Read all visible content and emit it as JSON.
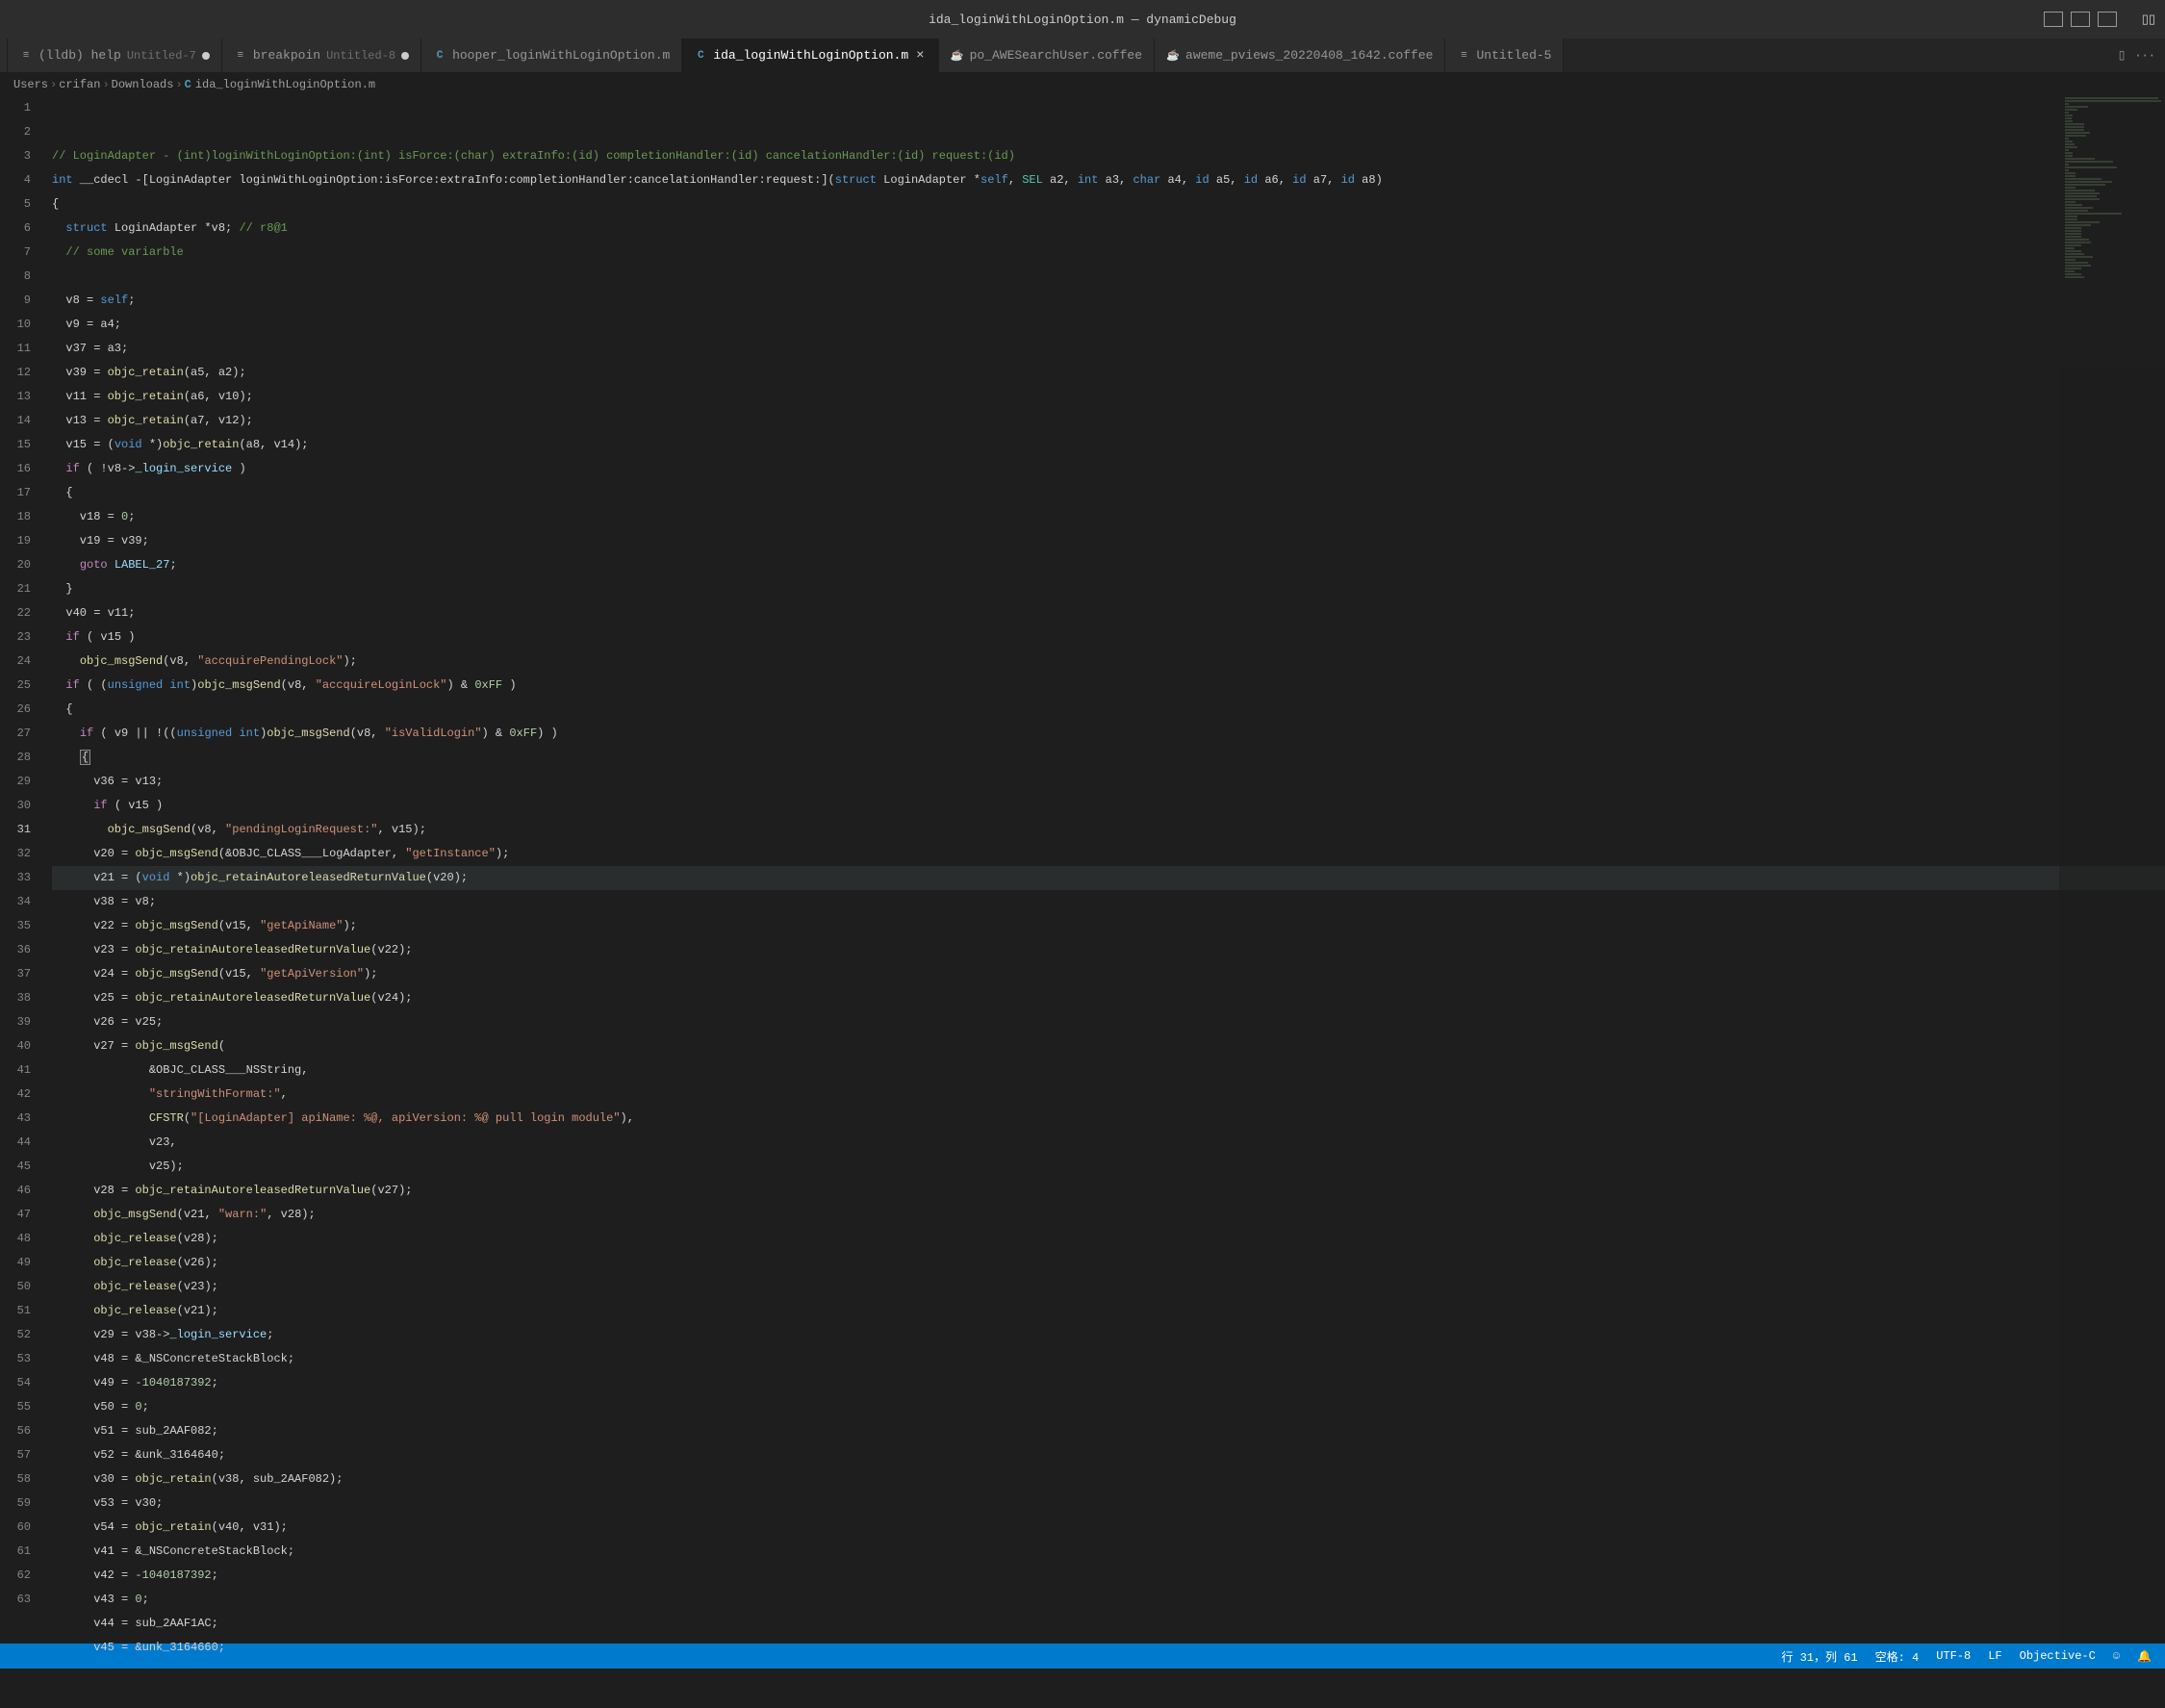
{
  "title": "ida_loginWithLoginOption.m — dynamicDebug",
  "tabs": [
    {
      "label": "(lldb) help",
      "sub": "Untitled-7",
      "icon": "text",
      "dirty": true
    },
    {
      "label": "breakpoin",
      "sub": "Untitled-8",
      "icon": "text",
      "dirty": true
    },
    {
      "label": "hooper_loginWithLoginOption.m",
      "icon": "C"
    },
    {
      "label": "ida_loginWithLoginOption.m",
      "icon": "C",
      "active": true,
      "closeable": true
    },
    {
      "label": "po_AWESearchUser.coffee",
      "icon": "coffee"
    },
    {
      "label": "aweme_pviews_20220408_1642.coffee",
      "icon": "coffee"
    },
    {
      "label": "Untitled-5",
      "icon": "text"
    }
  ],
  "breadcrumbs": {
    "parts": [
      "Users",
      "crifan",
      "Downloads"
    ],
    "file_icon": "C",
    "file": "ida_loginWithLoginOption.m"
  },
  "cursor": {
    "line": 31,
    "col": 61
  },
  "status": {
    "lncol": "行 31，列 61",
    "spaces": "空格: 4",
    "encoding": "UTF-8",
    "eol": "LF",
    "lang": "Objective-C"
  },
  "code": {
    "first_line": 1,
    "lines": [
      {
        "n": 1,
        "html": "<span class='c-comment'>// LoginAdapter - (int)loginWithLoginOption:(int) isForce:(char) extraInfo:(id) completionHandler:(id) cancelationHandler:(id) request:(id)</span>"
      },
      {
        "n": 2,
        "html": "<span class='c-type'>int</span> __cdecl -[LoginAdapter loginWithLoginOption:isForce:extraInfo:completionHandler:cancelationHandler:request:](<span class='c-type'>struct</span> LoginAdapter *<span class='c-self'>self</span>, <span class='c-enum'>SEL</span> a2, <span class='c-type'>int</span> a3, <span class='c-type'>char</span> a4, <span class='c-type'>id</span> a5, <span class='c-type'>id</span> a6, <span class='c-type'>id</span> a7, <span class='c-type'>id</span> a8)"
      },
      {
        "n": 3,
        "html": "{"
      },
      {
        "n": 4,
        "html": "  <span class='c-type'>struct</span> LoginAdapter *v8; <span class='c-comment'>// r8@1</span>"
      },
      {
        "n": 5,
        "html": "  <span class='c-comment'>// some variarble</span>"
      },
      {
        "n": 6,
        "html": ""
      },
      {
        "n": 7,
        "html": "  v8 = <span class='c-self'>self</span>;"
      },
      {
        "n": 8,
        "html": "  v9 = a4;"
      },
      {
        "n": 9,
        "html": "  v37 = a3;"
      },
      {
        "n": 10,
        "html": "  v39 = <span class='c-func'>objc_retain</span>(a5, a2);"
      },
      {
        "n": 11,
        "html": "  v11 = <span class='c-func'>objc_retain</span>(a6, v10);"
      },
      {
        "n": 12,
        "html": "  v13 = <span class='c-func'>objc_retain</span>(a7, v12);"
      },
      {
        "n": 13,
        "html": "  v15 = (<span class='c-type'>void</span> *)<span class='c-func'>objc_retain</span>(a8, v14);"
      },
      {
        "n": 14,
        "html": "  <span class='c-keyword'>if</span> ( !v8-&gt;<span class='c-prop'>_login_service</span> )"
      },
      {
        "n": 15,
        "html": "  {"
      },
      {
        "n": 16,
        "html": "    v18 = <span class='c-num'>0</span>;"
      },
      {
        "n": 17,
        "html": "    v19 = v39;"
      },
      {
        "n": 18,
        "html": "    <span class='c-keyword'>goto</span> <span class='c-var'>LABEL_27</span>;"
      },
      {
        "n": 19,
        "html": "  }"
      },
      {
        "n": 20,
        "html": "  v40 = v11;"
      },
      {
        "n": 21,
        "html": "  <span class='c-keyword'>if</span> ( v15 )"
      },
      {
        "n": 22,
        "html": "    <span class='c-func'>objc_msgSend</span>(v8, <span class='c-str'>\"accquirePendingLock\"</span>);"
      },
      {
        "n": 23,
        "html": "  <span class='c-keyword'>if</span> ( (<span class='c-type'>unsigned int</span>)<span class='c-func'>objc_msgSend</span>(v8, <span class='c-str'>\"accquireLoginLock\"</span>) &amp; <span class='c-num'>0xFF</span> )"
      },
      {
        "n": 24,
        "html": "  {"
      },
      {
        "n": 25,
        "html": "    <span class='c-keyword'>if</span> ( v9 || !((<span class='c-type'>unsigned int</span>)<span class='c-func'>objc_msgSend</span>(v8, <span class='c-str'>\"isValidLogin\"</span>) &amp; <span class='c-num'>0xFF</span>) )"
      },
      {
        "n": 26,
        "html": "    <span class='c-bracket-match'>{</span>"
      },
      {
        "n": 27,
        "html": "      v36 = v13;"
      },
      {
        "n": 28,
        "html": "      <span class='c-keyword'>if</span> ( v15 )"
      },
      {
        "n": 29,
        "html": "        <span class='c-func'>objc_msgSend</span>(v8, <span class='c-str'>\"pendingLoginRequest:\"</span>, v15);"
      },
      {
        "n": 30,
        "html": "      v20 = <span class='c-func'>objc_msgSend</span>(&amp;OBJC_CLASS___LogAdapter, <span class='c-str'>\"getInstance\"</span>);"
      },
      {
        "n": 31,
        "hl": true,
        "html": "      v21 = (<span class='c-type'>void</span> *)<span class='c-func'>objc_retainAutoreleasedReturnValue</span>(v20);"
      },
      {
        "n": 32,
        "html": "      v38 = v8;"
      },
      {
        "n": 33,
        "html": "      v22 = <span class='c-func'>objc_msgSend</span>(v15, <span class='c-str'>\"getApiName\"</span>);"
      },
      {
        "n": 34,
        "html": "      v23 = <span class='c-func'>objc_retainAutoreleasedReturnValue</span>(v22);"
      },
      {
        "n": 35,
        "html": "      v24 = <span class='c-func'>objc_msgSend</span>(v15, <span class='c-str'>\"getApiVersion\"</span>);"
      },
      {
        "n": 36,
        "html": "      v25 = <span class='c-func'>objc_retainAutoreleasedReturnValue</span>(v24);"
      },
      {
        "n": 37,
        "html": "      v26 = v25;"
      },
      {
        "n": 38,
        "html": "      v27 = <span class='c-func'>objc_msgSend</span>("
      },
      {
        "n": 39,
        "html": "              &amp;OBJC_CLASS___NSString,"
      },
      {
        "n": 40,
        "html": "              <span class='c-str'>\"stringWithFormat:\"</span>,"
      },
      {
        "n": 41,
        "html": "              <span class='c-func'>CFSTR</span>(<span class='c-str'>\"[LoginAdapter] apiName: %@, apiVersion: %@ pull login module\"</span>),"
      },
      {
        "n": 42,
        "html": "              v23,"
      },
      {
        "n": 43,
        "html": "              v25);"
      },
      {
        "n": 44,
        "html": "      v28 = <span class='c-func'>objc_retainAutoreleasedReturnValue</span>(v27);"
      },
      {
        "n": 45,
        "html": "      <span class='c-func'>objc_msgSend</span>(v21, <span class='c-str'>\"warn:\"</span>, v28);"
      },
      {
        "n": 46,
        "html": "      <span class='c-func'>objc_release</span>(v28);"
      },
      {
        "n": 47,
        "html": "      <span class='c-func'>objc_release</span>(v26);"
      },
      {
        "n": 48,
        "html": "      <span class='c-func'>objc_release</span>(v23);"
      },
      {
        "n": 49,
        "html": "      <span class='c-func'>objc_release</span>(v21);"
      },
      {
        "n": 50,
        "html": "      v29 = v38-&gt;<span class='c-prop'>_login_service</span>;"
      },
      {
        "n": 51,
        "html": "      v48 = &amp;_NSConcreteStackBlock;"
      },
      {
        "n": 52,
        "html": "      v49 = <span class='c-num'>-1040187392</span>;"
      },
      {
        "n": 53,
        "html": "      v50 = <span class='c-num'>0</span>;"
      },
      {
        "n": 54,
        "html": "      v51 = sub_2AAF082;"
      },
      {
        "n": 55,
        "html": "      v52 = &amp;unk_3164640;"
      },
      {
        "n": 56,
        "html": "      v30 = <span class='c-func'>objc_retain</span>(v38, sub_2AAF082);"
      },
      {
        "n": 57,
        "html": "      v53 = v30;"
      },
      {
        "n": 58,
        "html": "      v54 = <span class='c-func'>objc_retain</span>(v40, v31);"
      },
      {
        "n": 59,
        "html": "      v41 = &amp;_NSConcreteStackBlock;"
      },
      {
        "n": 60,
        "html": "      v42 = <span class='c-num'>-1040187392</span>;"
      },
      {
        "n": 61,
        "html": "      v43 = <span class='c-num'>0</span>;"
      },
      {
        "n": 62,
        "html": "      v44 = sub_2AAF1AC;"
      },
      {
        "n": 63,
        "html": "      v45 = &amp;unk_3164660;"
      }
    ]
  }
}
